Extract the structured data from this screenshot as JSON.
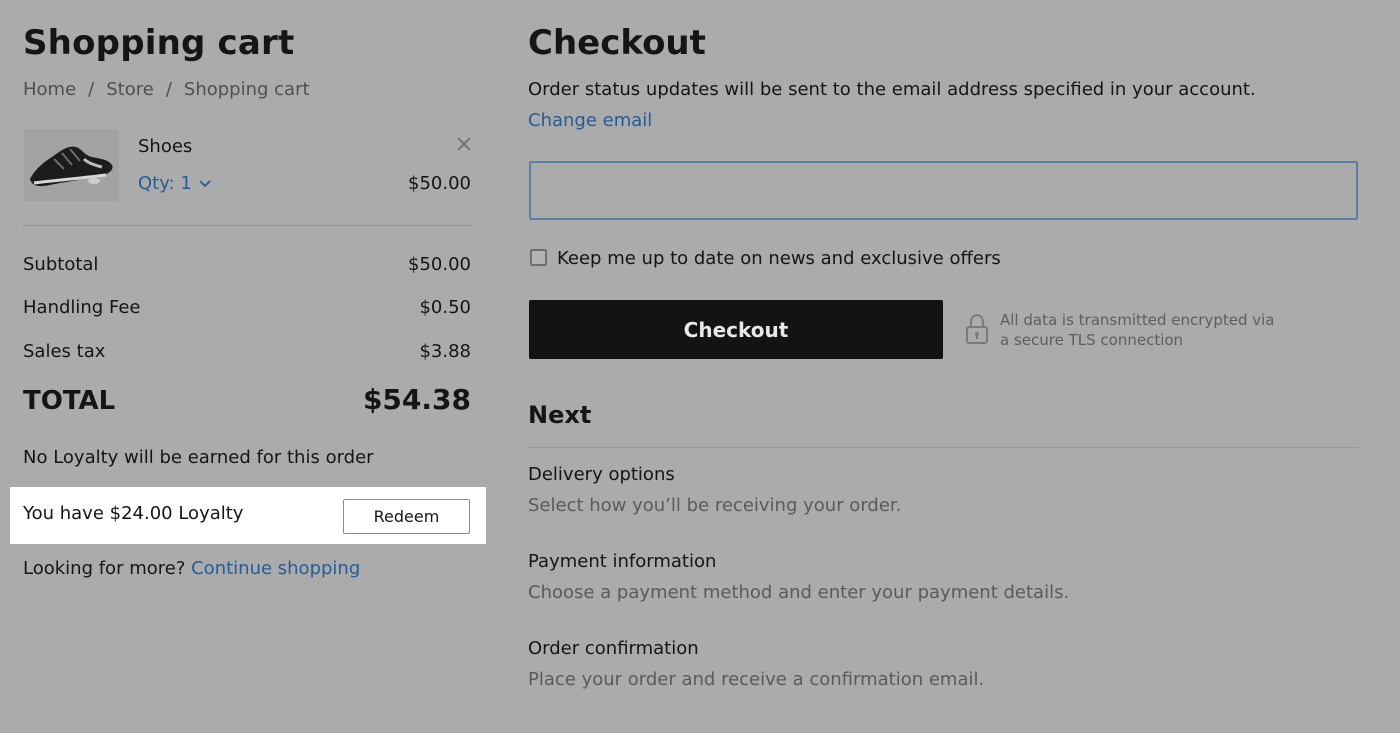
{
  "cart": {
    "title": "Shopping cart",
    "breadcrumb": [
      "Home",
      "Store",
      "Shopping cart"
    ],
    "breadcrumb_separator": "/",
    "item": {
      "name": "Shoes",
      "image_icon": "sneaker-image",
      "qty_label": "Qty: 1",
      "price": "$50.00",
      "remove_icon": "close-icon"
    },
    "summary": {
      "subtotal_label": "Subtotal",
      "subtotal_value": "$50.00",
      "handling_label": "Handling Fee",
      "handling_value": "$0.50",
      "tax_label": "Sales tax",
      "tax_value": "$3.88",
      "total_label": "TOTAL",
      "total_value": "$54.38"
    },
    "loyalty_note": "No Loyalty will be earned for this order",
    "loyalty_balance": "You have $24.00 Loyalty",
    "redeem_label": "Redeem",
    "more_prefix": "Looking for more?",
    "continue_label": "Continue shopping"
  },
  "checkout": {
    "title": "Checkout",
    "status_note": "Order status updates will be sent to the email address specified in your account.",
    "change_email_label": "Change email",
    "email_value": "",
    "newsletter_label": "Keep me up to date on news and exclusive offers",
    "newsletter_checked": false,
    "button_label": "Checkout",
    "secure_line1": "All data is transmitted encrypted via",
    "secure_line2": "a secure TLS connection",
    "secure_icon": "lock-icon"
  },
  "next": {
    "title": "Next",
    "steps": [
      {
        "title": "Delivery options",
        "desc": "Select how you’ll be receiving your order."
      },
      {
        "title": "Payment information",
        "desc": "Choose a payment method and enter your payment details."
      },
      {
        "title": "Order confirmation",
        "desc": "Place your order and receive a confirmation email."
      }
    ]
  },
  "colors": {
    "overlay_background": "#ababab",
    "link": "#235d98",
    "checkout_button": "#131313",
    "highlight_panel": "#ffffff"
  }
}
